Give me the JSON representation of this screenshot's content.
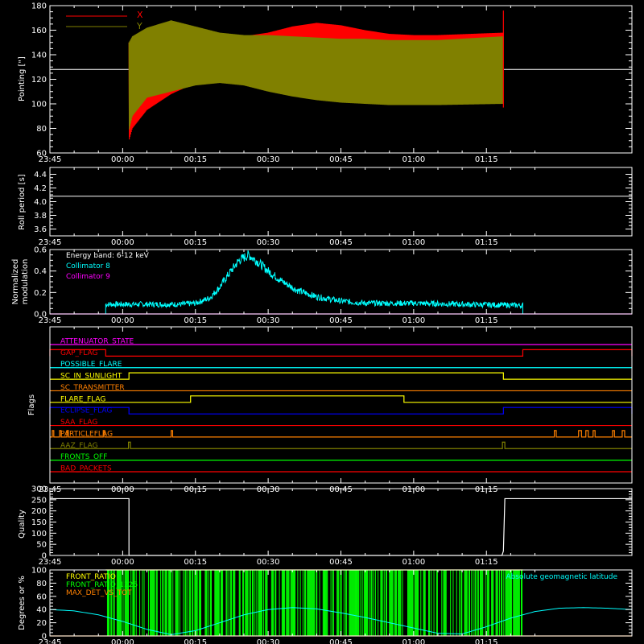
{
  "chart_data": [
    {
      "type": "line",
      "id": "pointing",
      "ylabel": "Pointing [\"]",
      "ylim": [
        60,
        180
      ],
      "yticks": [
        60,
        80,
        100,
        120,
        140,
        160,
        180
      ],
      "series": [
        {
          "name": "X",
          "color": "#ff0000",
          "envelope": {
            "t": [
              1.3,
              2,
              5,
              10,
              15,
              20,
              25,
              30,
              35,
              40,
              45,
              50,
              55,
              60,
              65,
              78.5
            ],
            "upper": [
              150,
              147,
              154,
              160,
              158,
              156,
              155,
              158,
              163,
              166,
              164,
              160,
              157,
              156,
              156,
              158
            ],
            "lower": [
              70,
              80,
              95,
              108,
              117,
              120,
              120,
              118,
              115,
              112,
              110,
              109,
              109,
              110,
              110,
              112
            ]
          }
        },
        {
          "name": "Y",
          "color": "#808000",
          "envelope": {
            "t": [
              1.3,
              2,
              5,
              10,
              15,
              20,
              25,
              30,
              35,
              40,
              45,
              50,
              55,
              60,
              65,
              78.5
            ],
            "upper": [
              150,
              155,
              162,
              168,
              163,
              158,
              156,
              156,
              155,
              154,
              153,
              153,
              152,
              152,
              152,
              155
            ],
            "lower": [
              78,
              90,
              105,
              110,
              115,
              117,
              115,
              110,
              106,
              103,
              101,
              100,
              99,
              99,
              99,
              100
            ]
          }
        }
      ],
      "reference_line": 128,
      "x_extent": [
        1.3,
        78.5
      ],
      "end_spike": {
        "t": 78.5,
        "values": [
          97,
          176
        ]
      }
    },
    {
      "type": "line",
      "id": "roll",
      "ylabel": "Roll period [s]",
      "ylim": [
        3.5,
        4.5
      ],
      "yticks": [
        3.6,
        3.8,
        4.0,
        4.2,
        4.4
      ],
      "series": [
        {
          "name": "",
          "color": "#ffffff",
          "x": [
            -15,
            105
          ],
          "y": [
            4.08,
            4.08
          ]
        }
      ]
    },
    {
      "type": "line",
      "id": "modulation",
      "ylabel": "Normalized modulation",
      "ylim": [
        0,
        0.6
      ],
      "yticks": [
        0.0,
        0.2,
        0.4,
        0.6
      ],
      "annotation": "Energy band: 6-12 keV",
      "series": [
        {
          "name": "Collimator 8",
          "color": "#00ffff",
          "profile": {
            "t": [
              -3.5,
              5,
              12,
              15,
              18,
              20,
              22,
              24,
              26,
              28,
              30,
              33,
              36,
              40,
              45,
              50,
              60,
              70,
              82.5
            ],
            "y": [
              0.09,
              0.09,
              0.09,
              0.1,
              0.15,
              0.25,
              0.38,
              0.5,
              0.55,
              0.48,
              0.4,
              0.3,
              0.22,
              0.16,
              0.12,
              0.1,
              0.1,
              0.09,
              0.08
            ]
          },
          "support": [
            -3.5,
            82.5
          ]
        },
        {
          "name": "Collimator 9",
          "color": "#ff00ff",
          "x": [
            -15,
            105
          ],
          "y": [
            0,
            0
          ]
        }
      ]
    },
    {
      "type": "table",
      "id": "flags",
      "ylabel": "Flags",
      "rows": [
        {
          "name": "ATTENUATOR_STATE",
          "color": "#ff00ff",
          "high": []
        },
        {
          "name": "GAP_FLAG",
          "color": "#ff0000",
          "high": [
            [
              -15,
              -3.5
            ],
            [
              82.5,
              105
            ]
          ]
        },
        {
          "name": "POSSIBLE_FLARE",
          "color": "#00ffff",
          "high": []
        },
        {
          "name": "SC_IN_SUNLIGHT",
          "color": "#ffff00",
          "high": [
            [
              1.3,
              78.5
            ]
          ]
        },
        {
          "name": "SC_TRANSMITTER",
          "color": "#ff8000",
          "high": []
        },
        {
          "name": "FLARE_FLAG",
          "color": "#ffff00",
          "high": [
            [
              14,
              58
            ]
          ]
        },
        {
          "name": "ECLIPSE_FLAG",
          "color": "#0000ff",
          "high": [
            [
              -15,
              1.3
            ],
            [
              78.5,
              105
            ]
          ]
        },
        {
          "name": "SAA_FLAG",
          "color": "#ff0000",
          "high": []
        },
        {
          "name": "PARTICLEFLAG",
          "color": "#ff8000",
          "high": [
            [
              -14.5,
              -14.2
            ],
            [
              -13,
              -12.7
            ],
            [
              -11.5,
              -11.2
            ],
            [
              -4,
              -3.7
            ],
            [
              10,
              10.3
            ],
            [
              89,
              89.4
            ],
            [
              94,
              94.6
            ],
            [
              95.5,
              96
            ],
            [
              97,
              97.4
            ],
            [
              101,
              101.4
            ],
            [
              103,
              103.5
            ]
          ]
        },
        {
          "name": "AAZ_FLAG",
          "color": "#808000",
          "high": [
            [
              1.2,
              1.6
            ],
            [
              78.3,
              78.8
            ]
          ]
        },
        {
          "name": "FRONTS_OFF",
          "color": "#00ff00",
          "high": []
        },
        {
          "name": "BAD_PACKETS",
          "color": "#ff0000",
          "high": []
        }
      ]
    },
    {
      "type": "line",
      "id": "quality",
      "ylabel": "Quality",
      "ylim": [
        0,
        300
      ],
      "yticks": [
        0,
        50,
        100,
        150,
        200,
        250,
        300
      ],
      "series": [
        {
          "name": "",
          "color": "#ffffff",
          "x": [
            -15,
            -3.5,
            -3.5,
            1.3,
            1.3,
            78.2,
            78.5,
            78.8,
            105
          ],
          "y": [
            255,
            255,
            255,
            255,
            0,
            0,
            20,
            255,
            255
          ]
        }
      ]
    },
    {
      "type": "bar",
      "id": "ratios",
      "ylabel": "Degrees or %",
      "ylim": [
        0,
        100
      ],
      "yticks": [
        0,
        20,
        40,
        60,
        80,
        100
      ],
      "series": [
        {
          "name": "FRONT_RATIO",
          "color": "#ffff00",
          "support": [
            -3.5,
            82.5
          ]
        },
        {
          "name": "FRONT_RATIO_1225",
          "color": "#00ff00",
          "support": [
            -3.5,
            82.5
          ]
        },
        {
          "name": "MAX_DET_VS_TOT",
          "color": "#ff8000",
          "x": [
            -15,
            105
          ],
          "y": [
            0,
            0
          ]
        },
        {
          "name": "Absolute geomagnetic latitude",
          "color": "#00ffff",
          "x": [
            -15,
            -10,
            -5,
            0,
            5,
            10,
            15,
            20,
            25,
            30,
            35,
            40,
            45,
            50,
            55,
            60,
            65,
            70,
            75,
            80,
            85,
            90,
            95,
            100,
            105
          ],
          "y": [
            40,
            38,
            32,
            22,
            10,
            2,
            8,
            20,
            32,
            40,
            43,
            41,
            35,
            28,
            20,
            12,
            4,
            3,
            14,
            27,
            37,
            42,
            43,
            42,
            40
          ]
        }
      ]
    }
  ],
  "x_axis": {
    "range_minutes": [
      -15,
      105
    ],
    "ticks": [
      {
        "t": -15,
        "label": "23:45"
      },
      {
        "t": 0,
        "label": "00:00"
      },
      {
        "t": 15,
        "label": "00:15"
      },
      {
        "t": 30,
        "label": "00:30"
      },
      {
        "t": 45,
        "label": "00:45"
      },
      {
        "t": 60,
        "label": "01:00"
      },
      {
        "t": 75,
        "label": "01:15"
      }
    ]
  }
}
